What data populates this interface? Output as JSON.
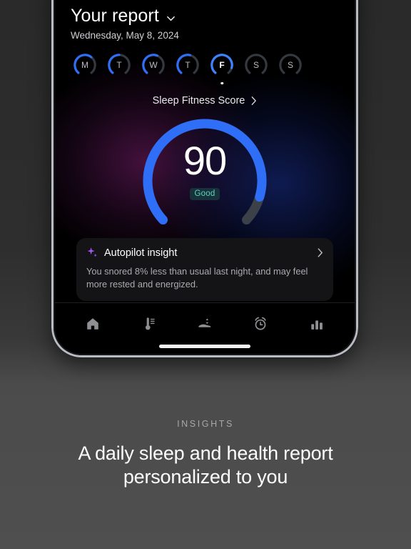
{
  "accent": {
    "blue": "#2f6ef6",
    "blue_bright": "#3d82ff",
    "track_gray": "#3c4049",
    "badge_text": "#5ed3bf",
    "badge_bg": "#17323a",
    "purple": "#a855f7"
  },
  "header": {
    "title": "Your report",
    "chevron_icon": "chevron-down-icon",
    "date": "Wednesday, May 8, 2024"
  },
  "days": [
    {
      "letter": "M",
      "progress": 64,
      "selected": false
    },
    {
      "letter": "T",
      "progress": 50,
      "selected": false
    },
    {
      "letter": "W",
      "progress": 58,
      "selected": false
    },
    {
      "letter": "T",
      "progress": 55,
      "selected": false
    },
    {
      "letter": "F",
      "progress": 88,
      "selected": true
    },
    {
      "letter": "S",
      "progress": 0,
      "selected": false
    },
    {
      "letter": "S",
      "progress": 0,
      "selected": false
    }
  ],
  "sleep_fitness": {
    "label": "Sleep Fitness Score",
    "chevron_icon": "chevron-right-icon",
    "score": "90",
    "rating": "Good",
    "gauge_percent": 90
  },
  "insight_card": {
    "icon": "sparkle-icon",
    "title": "Autopilot insight",
    "chevron_icon": "chevron-right-icon",
    "body": "You snored 8% less than usual last night, and may feel more rested and energized."
  },
  "nav": [
    {
      "icon": "home-icon",
      "label": "Home"
    },
    {
      "icon": "thermometer-icon",
      "label": "Temperature"
    },
    {
      "icon": "bed-height-icon",
      "label": "Bed"
    },
    {
      "icon": "alarm-clock-icon",
      "label": "Alarm"
    },
    {
      "icon": "bar-chart-icon",
      "label": "Insights"
    }
  ],
  "marketing": {
    "eyebrow": "INSIGHTS",
    "headline_line1": "A daily sleep and health report",
    "headline_line2": "personalized to you"
  },
  "chart_data": {
    "type": "gauge",
    "title": "Sleep Fitness Score",
    "value": 90,
    "rating": "Good",
    "range": [
      0,
      100
    ],
    "weekly": {
      "categories": [
        "M",
        "T",
        "W",
        "T",
        "F",
        "S",
        "S"
      ],
      "values": [
        64,
        50,
        58,
        55,
        88,
        0,
        0
      ],
      "selected_index": 4
    }
  }
}
